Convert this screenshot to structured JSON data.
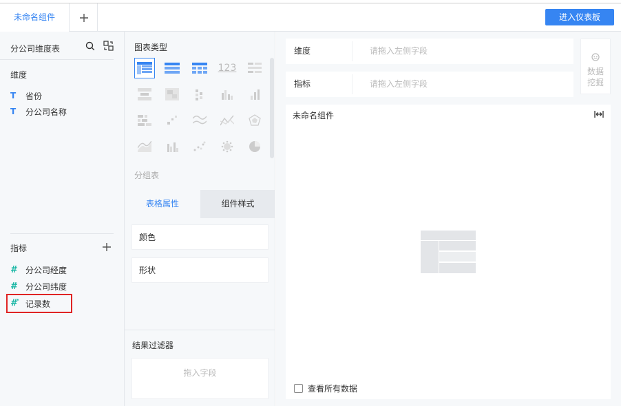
{
  "tabs": {
    "active_tab": "未命名组件",
    "dashboard_button": "进入仪表板"
  },
  "left": {
    "table_name": "分公司维度表",
    "dimension_label": "维度",
    "dimensions": [
      "省份",
      "分公司名称"
    ],
    "metric_label": "指标",
    "metrics": [
      "分公司经度",
      "分公司纬度",
      "记录数"
    ]
  },
  "middle": {
    "chart_type_title": "图表类型",
    "group_label": "分组表",
    "tab_table_props": "表格属性",
    "tab_component_style": "组件样式",
    "color_label": "颜色",
    "shape_label": "形状",
    "filter_title": "结果过滤器",
    "filter_placeholder": "拖入字段"
  },
  "right": {
    "dimension_label": "维度",
    "dimension_placeholder": "请拖入左侧字段",
    "metric_label": "指标",
    "metric_placeholder": "请拖入左侧字段",
    "mining_line1": "数据",
    "mining_line2": "挖掘",
    "canvas_title": "未命名组件",
    "view_all_data": "查看所有数据"
  },
  "colors": {
    "accent": "#3685f2",
    "metric_icon": "#1ab7a5",
    "highlight": "#e02424"
  }
}
